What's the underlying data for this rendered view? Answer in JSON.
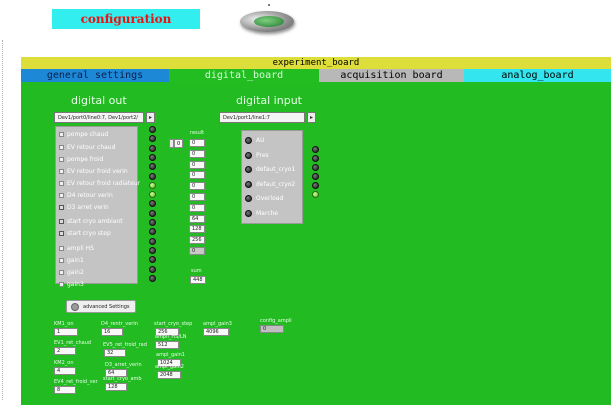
{
  "header": {
    "config_label": "configuration"
  },
  "board": {
    "title": "experiment_board",
    "tabs": [
      "general settings",
      "digital_board",
      "acquisition board",
      "analog_board"
    ],
    "active_tab": "digital_board"
  },
  "digital_out": {
    "title": "digital out",
    "channel_value": "Dev1/port0/line0:7, Dev1/port2/",
    "items": [
      {
        "label": "pompe chaud",
        "checked": false
      },
      {
        "label": "EV retour chaud",
        "checked": false
      },
      {
        "label": "pompe froid",
        "checked": false
      },
      {
        "label": "EV retour froid verin",
        "checked": false
      },
      {
        "label": "EV retour froid radiateur",
        "checked": false
      },
      {
        "label": "D4 retour verin",
        "checked": false
      },
      {
        "label": "D3 arret verin",
        "checked": true
      },
      {
        "label": "start cryo ambiant",
        "checked": true
      },
      {
        "label": "start cryo step",
        "checked": true
      },
      {
        "label": "ampli HS",
        "checked": false
      },
      {
        "label": "gain1",
        "checked": false
      },
      {
        "label": "gain2",
        "checked": false
      },
      {
        "label": "gain3",
        "checked": false
      }
    ],
    "leds": [
      false,
      false,
      false,
      false,
      false,
      false,
      true,
      true,
      false,
      false,
      false,
      false,
      false,
      false,
      false,
      false,
      false
    ]
  },
  "index": {
    "value": "0"
  },
  "result": {
    "label": "result",
    "values": [
      "0",
      "0",
      "0",
      "0",
      "0",
      "0",
      "0",
      "64",
      "128",
      "256",
      "0"
    ],
    "sum_label": "sum",
    "sum_value": "448"
  },
  "digital_input": {
    "title": "digital input",
    "channel_value": "Dev1/port1/line1:7",
    "items": [
      {
        "label": "AU",
        "on": false
      },
      {
        "label": "Pres",
        "on": false
      },
      {
        "label": "defaut_cryo1",
        "on": false
      },
      {
        "label": "defaut_cryo2",
        "on": false
      },
      {
        "label": "Overload",
        "on": false
      },
      {
        "label": "Marche",
        "on": false
      }
    ],
    "leds": [
      false,
      false,
      false,
      false,
      false,
      true
    ]
  },
  "advanced": {
    "label": "advanced Settings"
  },
  "fields": [
    {
      "label": "KM1_on",
      "value": "1"
    },
    {
      "label": "EV1_ret_chaud",
      "value": "2"
    },
    {
      "label": "KM2_on",
      "value": "4"
    },
    {
      "label": "EV4_ret_froid_ver",
      "value": "8"
    },
    {
      "label": "D4_rentr_verin",
      "value": "16"
    },
    {
      "label": "EV5_ret_froid_rad",
      "value": "32"
    },
    {
      "label": "D3_arret_verin",
      "value": "64"
    },
    {
      "label": "start_cryo_amb",
      "value": "128"
    },
    {
      "label": "start_cryo_step",
      "value": "256"
    },
    {
      "label": "ampli_HS/LN",
      "value": "512"
    },
    {
      "label": "ampl_gain1",
      "value": "1024"
    },
    {
      "label": "ampl_gain2",
      "value": "2048"
    },
    {
      "label": "ampl_gain3",
      "value": "4096"
    },
    {
      "label": "config_ampli",
      "value": "0"
    }
  ],
  "colors": {
    "panel": "#22bb22",
    "tab_general": "#1c88d6",
    "tab_digital": "#21bd21",
    "tab_acquisition": "#b8b8b8",
    "tab_analog": "#33e5ee",
    "board_bar": "#dede3a",
    "config_bg": "#33eeee",
    "config_text": "#ee1111"
  }
}
